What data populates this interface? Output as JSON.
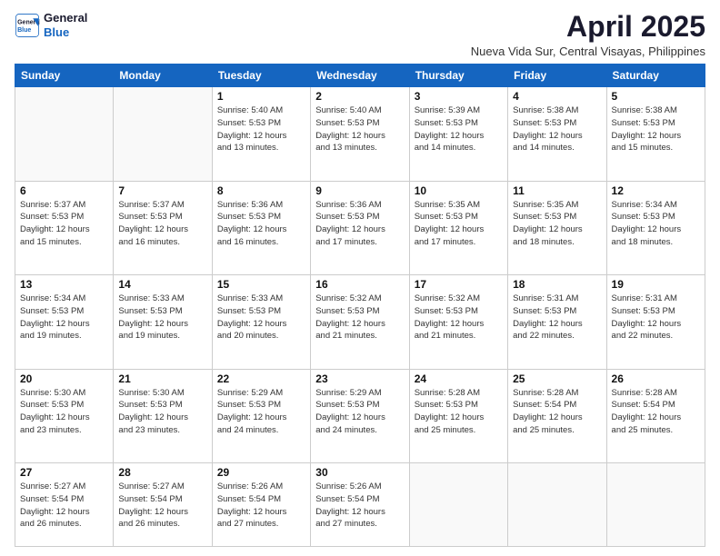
{
  "logo": {
    "line1": "General",
    "line2": "Blue"
  },
  "title": "April 2025",
  "subtitle": "Nueva Vida Sur, Central Visayas, Philippines",
  "days_header": [
    "Sunday",
    "Monday",
    "Tuesday",
    "Wednesday",
    "Thursday",
    "Friday",
    "Saturday"
  ],
  "weeks": [
    [
      {
        "day": "",
        "info": ""
      },
      {
        "day": "",
        "info": ""
      },
      {
        "day": "1",
        "info": "Sunrise: 5:40 AM\nSunset: 5:53 PM\nDaylight: 12 hours\nand 13 minutes."
      },
      {
        "day": "2",
        "info": "Sunrise: 5:40 AM\nSunset: 5:53 PM\nDaylight: 12 hours\nand 13 minutes."
      },
      {
        "day": "3",
        "info": "Sunrise: 5:39 AM\nSunset: 5:53 PM\nDaylight: 12 hours\nand 14 minutes."
      },
      {
        "day": "4",
        "info": "Sunrise: 5:38 AM\nSunset: 5:53 PM\nDaylight: 12 hours\nand 14 minutes."
      },
      {
        "day": "5",
        "info": "Sunrise: 5:38 AM\nSunset: 5:53 PM\nDaylight: 12 hours\nand 15 minutes."
      }
    ],
    [
      {
        "day": "6",
        "info": "Sunrise: 5:37 AM\nSunset: 5:53 PM\nDaylight: 12 hours\nand 15 minutes."
      },
      {
        "day": "7",
        "info": "Sunrise: 5:37 AM\nSunset: 5:53 PM\nDaylight: 12 hours\nand 16 minutes."
      },
      {
        "day": "8",
        "info": "Sunrise: 5:36 AM\nSunset: 5:53 PM\nDaylight: 12 hours\nand 16 minutes."
      },
      {
        "day": "9",
        "info": "Sunrise: 5:36 AM\nSunset: 5:53 PM\nDaylight: 12 hours\nand 17 minutes."
      },
      {
        "day": "10",
        "info": "Sunrise: 5:35 AM\nSunset: 5:53 PM\nDaylight: 12 hours\nand 17 minutes."
      },
      {
        "day": "11",
        "info": "Sunrise: 5:35 AM\nSunset: 5:53 PM\nDaylight: 12 hours\nand 18 minutes."
      },
      {
        "day": "12",
        "info": "Sunrise: 5:34 AM\nSunset: 5:53 PM\nDaylight: 12 hours\nand 18 minutes."
      }
    ],
    [
      {
        "day": "13",
        "info": "Sunrise: 5:34 AM\nSunset: 5:53 PM\nDaylight: 12 hours\nand 19 minutes."
      },
      {
        "day": "14",
        "info": "Sunrise: 5:33 AM\nSunset: 5:53 PM\nDaylight: 12 hours\nand 19 minutes."
      },
      {
        "day": "15",
        "info": "Sunrise: 5:33 AM\nSunset: 5:53 PM\nDaylight: 12 hours\nand 20 minutes."
      },
      {
        "day": "16",
        "info": "Sunrise: 5:32 AM\nSunset: 5:53 PM\nDaylight: 12 hours\nand 21 minutes."
      },
      {
        "day": "17",
        "info": "Sunrise: 5:32 AM\nSunset: 5:53 PM\nDaylight: 12 hours\nand 21 minutes."
      },
      {
        "day": "18",
        "info": "Sunrise: 5:31 AM\nSunset: 5:53 PM\nDaylight: 12 hours\nand 22 minutes."
      },
      {
        "day": "19",
        "info": "Sunrise: 5:31 AM\nSunset: 5:53 PM\nDaylight: 12 hours\nand 22 minutes."
      }
    ],
    [
      {
        "day": "20",
        "info": "Sunrise: 5:30 AM\nSunset: 5:53 PM\nDaylight: 12 hours\nand 23 minutes."
      },
      {
        "day": "21",
        "info": "Sunrise: 5:30 AM\nSunset: 5:53 PM\nDaylight: 12 hours\nand 23 minutes."
      },
      {
        "day": "22",
        "info": "Sunrise: 5:29 AM\nSunset: 5:53 PM\nDaylight: 12 hours\nand 24 minutes."
      },
      {
        "day": "23",
        "info": "Sunrise: 5:29 AM\nSunset: 5:53 PM\nDaylight: 12 hours\nand 24 minutes."
      },
      {
        "day": "24",
        "info": "Sunrise: 5:28 AM\nSunset: 5:53 PM\nDaylight: 12 hours\nand 25 minutes."
      },
      {
        "day": "25",
        "info": "Sunrise: 5:28 AM\nSunset: 5:54 PM\nDaylight: 12 hours\nand 25 minutes."
      },
      {
        "day": "26",
        "info": "Sunrise: 5:28 AM\nSunset: 5:54 PM\nDaylight: 12 hours\nand 25 minutes."
      }
    ],
    [
      {
        "day": "27",
        "info": "Sunrise: 5:27 AM\nSunset: 5:54 PM\nDaylight: 12 hours\nand 26 minutes."
      },
      {
        "day": "28",
        "info": "Sunrise: 5:27 AM\nSunset: 5:54 PM\nDaylight: 12 hours\nand 26 minutes."
      },
      {
        "day": "29",
        "info": "Sunrise: 5:26 AM\nSunset: 5:54 PM\nDaylight: 12 hours\nand 27 minutes."
      },
      {
        "day": "30",
        "info": "Sunrise: 5:26 AM\nSunset: 5:54 PM\nDaylight: 12 hours\nand 27 minutes."
      },
      {
        "day": "",
        "info": ""
      },
      {
        "day": "",
        "info": ""
      },
      {
        "day": "",
        "info": ""
      }
    ]
  ]
}
